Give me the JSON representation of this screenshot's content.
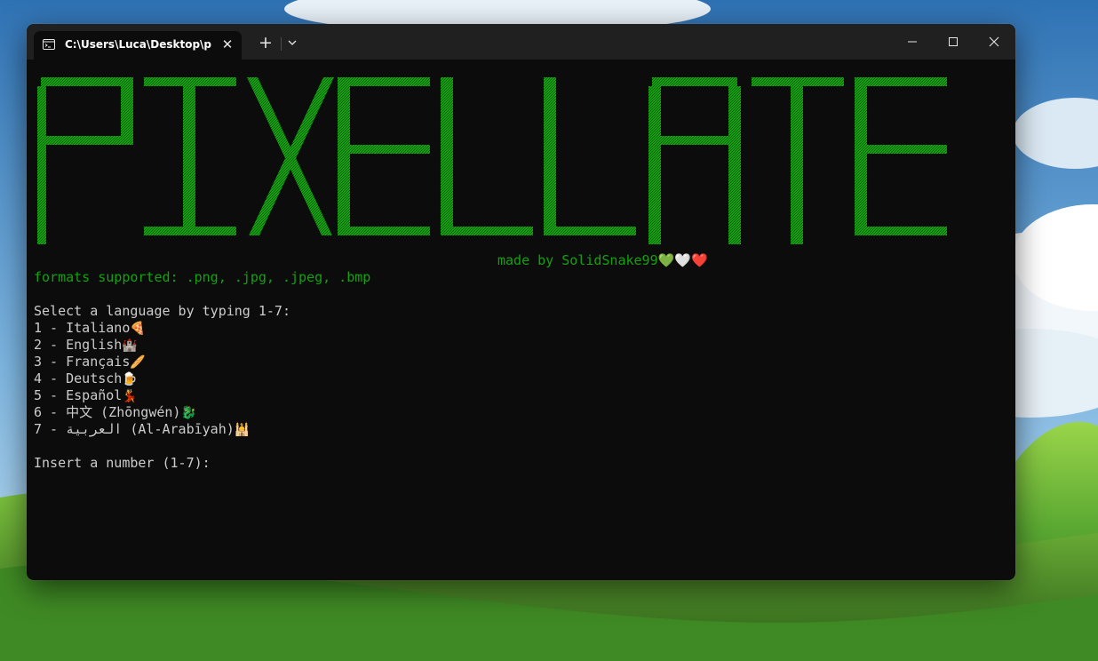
{
  "window": {
    "tab_title": "C:\\Users\\Luca\\Desktop\\pixella",
    "icons": {
      "tab": "console-icon",
      "close_tab": "close-icon",
      "new_tab": "plus-icon",
      "dropdown": "chevron-down-icon",
      "minimize": "minimize-icon",
      "maximize": "maximize-icon",
      "close": "close-icon"
    }
  },
  "console": {
    "banner_word": "PIXELLATE",
    "made_by": "made by SolidSnake99💚🤍❤️",
    "formats": "formats supported: .png, .jpg, .jpeg, .bmp",
    "select_prompt": "Select a language by typing 1-7:",
    "options": [
      {
        "number": "1",
        "label": "Italiano",
        "emoji": "🍕"
      },
      {
        "number": "2",
        "label": "English",
        "emoji": "🏰"
      },
      {
        "number": "3",
        "label": "Français",
        "emoji": "🥖"
      },
      {
        "number": "4",
        "label": "Deutsch",
        "emoji": "🍺"
      },
      {
        "number": "5",
        "label": "Español",
        "emoji": "💃"
      },
      {
        "number": "6",
        "label": "中文 (Zhōngwén)",
        "emoji": "🐉"
      },
      {
        "number": "7",
        "label": "العربية (Al-Arabīyah)",
        "emoji": "🕌"
      }
    ],
    "input_prompt": "Insert a number (1-7):"
  },
  "colors": {
    "banner_green": "#13a10e",
    "terminal_background": "#0c0c0c",
    "terminal_text": "#cccccc",
    "titlebar": "#202020"
  }
}
